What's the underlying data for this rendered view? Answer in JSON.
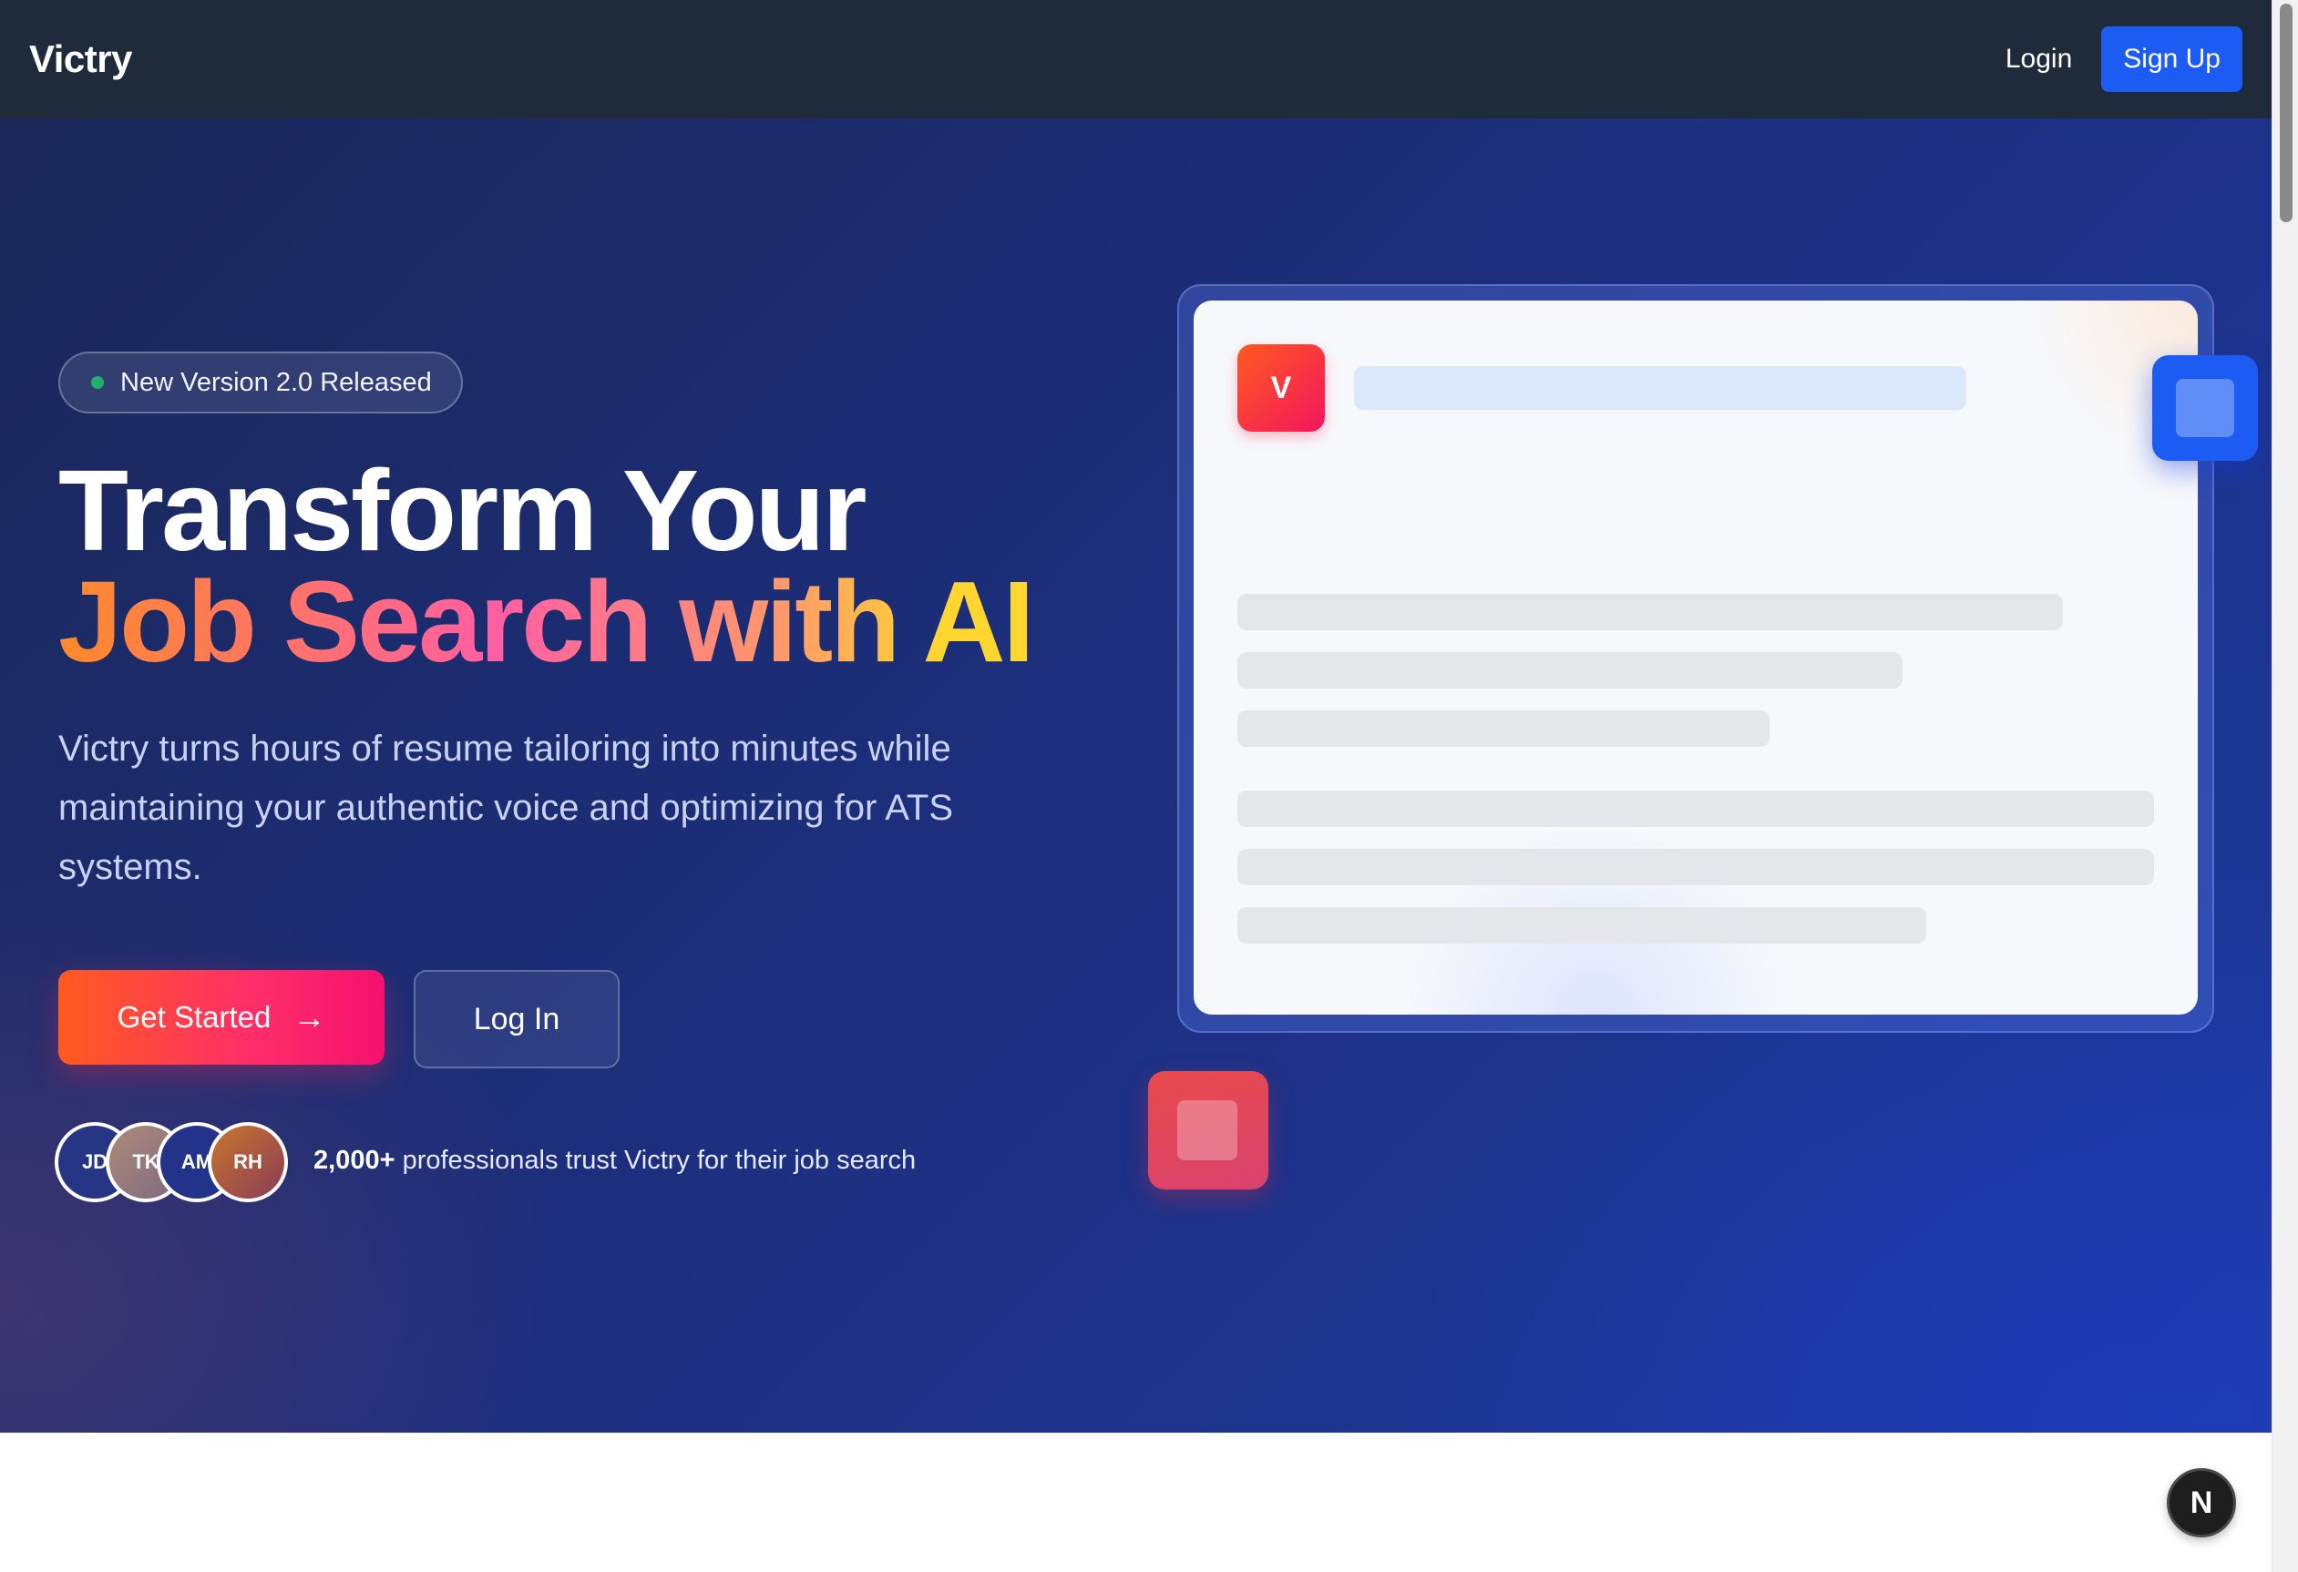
{
  "nav": {
    "brand": "Victry",
    "login_label": "Login",
    "signup_label": "Sign Up"
  },
  "hero": {
    "badge": "New Version 2.0 Released",
    "headline_line1": "Transform Your",
    "headline_line2": "Job Search with AI",
    "lead": "Victry turns hours of resume tailoring into minutes while maintaining your authentic voice and optimizing for ATS systems.",
    "cta_primary": "Get Started",
    "cta_primary_icon": "→",
    "cta_secondary": "Log In",
    "avatars": [
      "JD",
      "TK",
      "AM",
      "RH"
    ],
    "trust_count": "2,000+",
    "trust_text": " professionals trust Victry for their job search"
  },
  "mockup": {
    "logo_letter": "V"
  },
  "dev_badge": "N",
  "colors": {
    "nav_bg": "#1f2a3b",
    "accent_blue": "#1d5cf2",
    "cta_gradient_start": "#ff5b1f",
    "cta_gradient_end": "#f4126e",
    "badge_dot": "#20b26a"
  }
}
